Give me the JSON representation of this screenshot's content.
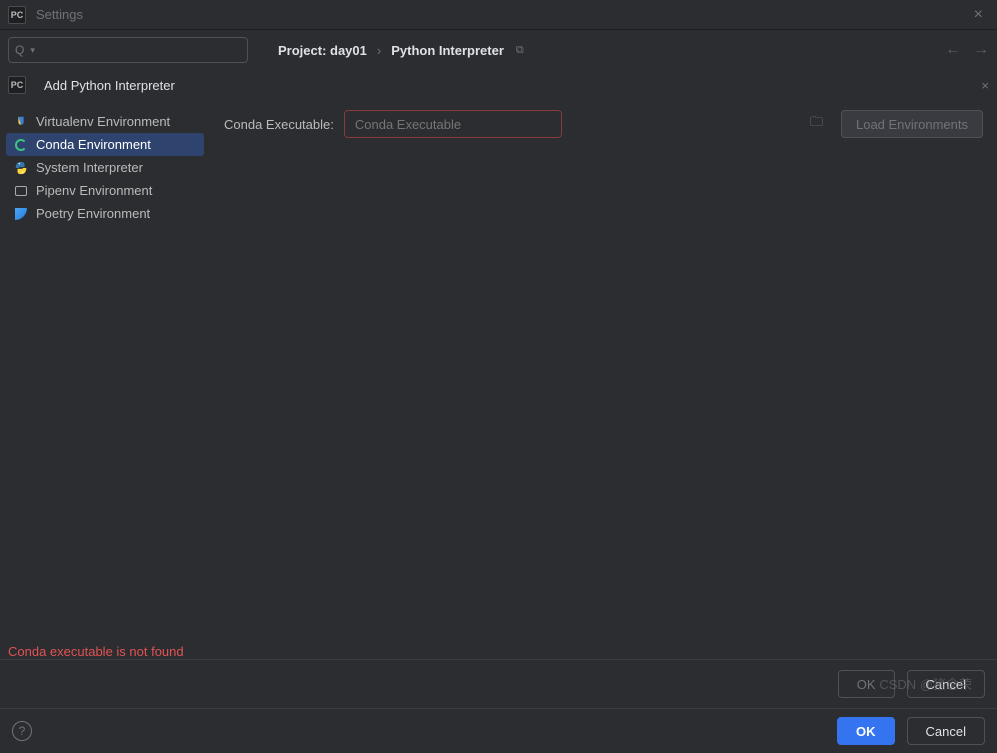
{
  "window": {
    "title": "Settings"
  },
  "breadcrumb": {
    "project_label": "Project: day01",
    "page_label": "Python Interpreter"
  },
  "subheader": {
    "title": "Add Python Interpreter"
  },
  "sidebar": {
    "items": [
      "Virtualenv Environment",
      "Conda Environment",
      "System Interpreter",
      "Pipenv Environment",
      "Poetry Environment"
    ],
    "selected_index": 1
  },
  "form": {
    "label": "Conda Executable:",
    "placeholder": "Conda Executable",
    "value": "",
    "load_button": "Load Environments"
  },
  "error": "Conda executable is not found",
  "buttons": {
    "ok": "OK",
    "cancel": "Cancel"
  },
  "watermark": "CSDN @猪念荣"
}
